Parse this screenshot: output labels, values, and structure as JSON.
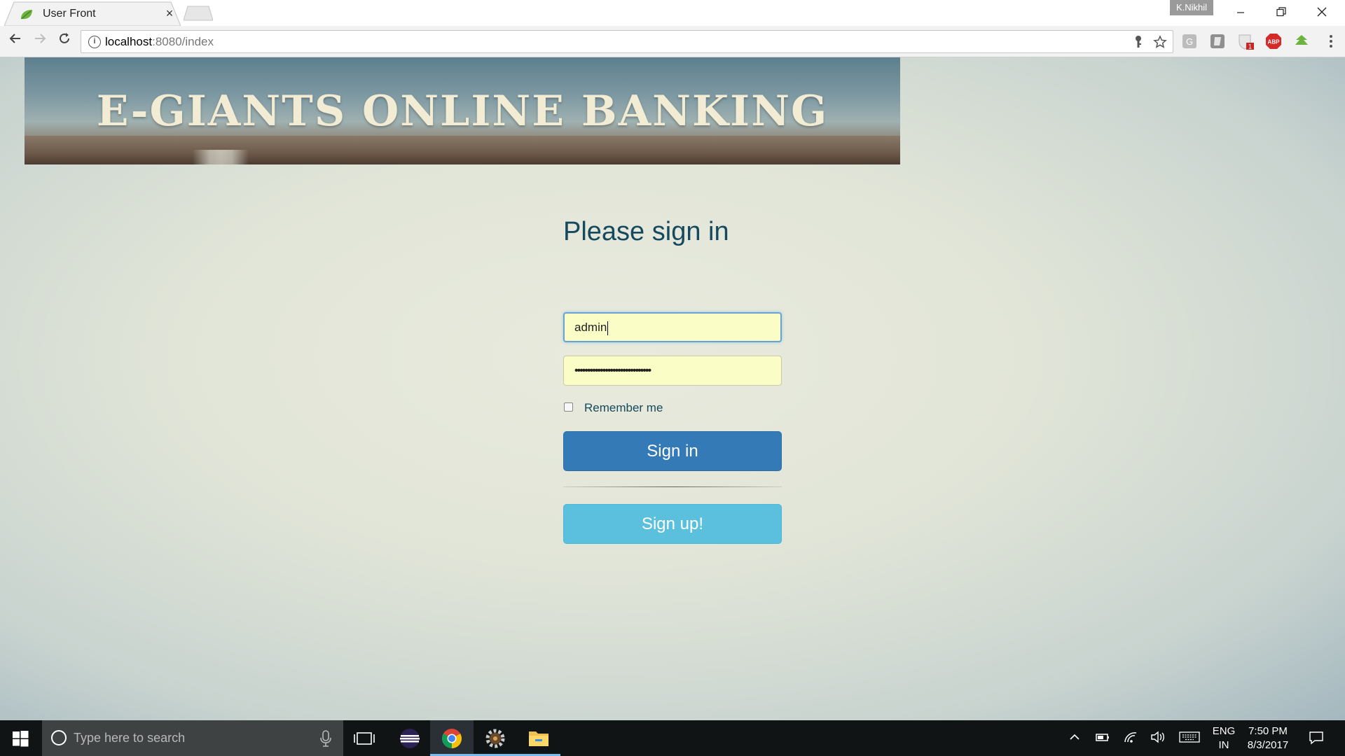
{
  "browser": {
    "tab_title": "User Front",
    "tab_close": "×",
    "profile_name": "K.Nikhil",
    "url_host": "localhost",
    "url_path": ":8080/index"
  },
  "page": {
    "banner_title": "E-GIANTS ONLINE BANKING",
    "heading": "Please sign in",
    "username_value": "admin",
    "password_mask": "••••••••••••••••••••••••••••••",
    "remember_label": "Remember me",
    "signin_label": "Sign in",
    "signup_label": "Sign up!"
  },
  "taskbar": {
    "search_placeholder": "Type here to search",
    "lang_line1": "ENG",
    "lang_line2": "IN",
    "time": "7:50 PM",
    "date": "8/3/2017"
  },
  "colors": {
    "primary_button": "#337ab7",
    "info_button": "#5bc0de",
    "heading": "#154a5e",
    "autofill": "#fbfdc6"
  }
}
